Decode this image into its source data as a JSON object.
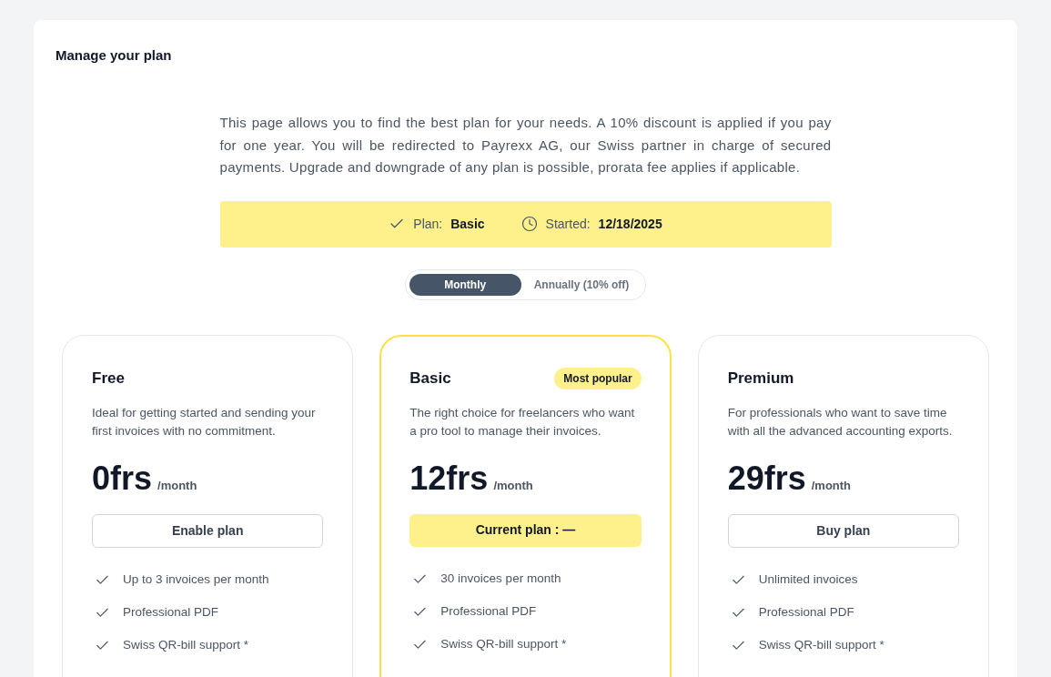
{
  "page": {
    "title": "Manage your plan"
  },
  "intro": "This page allows you to find the best plan for your needs. A 10% discount is applied if you pay for one year. You will be redirected to Payrexx AG, our Swiss partner in charge of secured payments. Upgrade and downgrade of any plan is possible, prorata fee applies if applicable.",
  "current_plan": {
    "items": [
      {
        "kind": "plan",
        "label": "Plan:",
        "value": "Basic"
      },
      {
        "kind": "started",
        "label": "Started:",
        "value": "12/18/2025"
      }
    ]
  },
  "billing_toggle": [
    {
      "label": "Monthly",
      "selected": true
    },
    {
      "label": "Annually (10% off)",
      "selected": false
    }
  ],
  "plans": [
    {
      "name": "Free",
      "highlighted": false,
      "description": "Ideal for getting started and sending your first invoices with no commitment.",
      "price": "0frs",
      "period": "/month",
      "button": {
        "label": "Enable plan",
        "current": false
      },
      "features": [
        "Up to 3 invoices per month",
        "Professional PDF",
        "Swiss QR-bill support *"
      ]
    },
    {
      "name": "Basic",
      "badge": "Most popular",
      "highlighted": true,
      "description": "The right choice for freelancers who want a pro tool to manage their invoices.",
      "price": "12frs",
      "period": "/month",
      "button": {
        "label": "Current plan : —",
        "current": true
      },
      "features": [
        "30 invoices per month",
        "Professional PDF",
        "Swiss QR-bill support *"
      ]
    },
    {
      "name": "Premium",
      "highlighted": false,
      "description": "For professionals who want to save time with all the advanced accounting exports.",
      "price": "29frs",
      "period": "/month",
      "button": {
        "label": "Buy plan",
        "current": false
      },
      "features": [
        "Unlimited invoices",
        "Professional PDF",
        "Swiss QR-bill support *"
      ]
    }
  ]
}
